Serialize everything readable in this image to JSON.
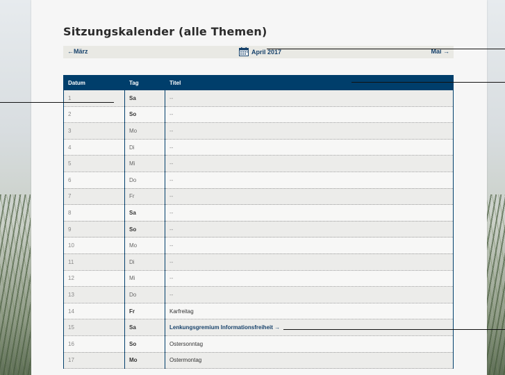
{
  "page": {
    "title": "Sitzungskalender (alle Themen)"
  },
  "nav": {
    "prev": "←März",
    "current": "April 2017",
    "next": "Mai →"
  },
  "table": {
    "headers": [
      "Datum",
      "Tag",
      "Titel"
    ],
    "rows": [
      {
        "date": "1",
        "day": "Sa",
        "title": "--"
      },
      {
        "date": "2",
        "day": "So",
        "title": "--"
      },
      {
        "date": "3",
        "day": "Mo",
        "title": "--"
      },
      {
        "date": "4",
        "day": "Di",
        "title": "--"
      },
      {
        "date": "5",
        "day": "Mi",
        "title": "--"
      },
      {
        "date": "6",
        "day": "Do",
        "title": "--"
      },
      {
        "date": "7",
        "day": "Fr",
        "title": "--"
      },
      {
        "date": "8",
        "day": "Sa",
        "title": "--"
      },
      {
        "date": "9",
        "day": "So",
        "title": "--"
      },
      {
        "date": "10",
        "day": "Mo",
        "title": "--"
      },
      {
        "date": "11",
        "day": "Di",
        "title": "--"
      },
      {
        "date": "12",
        "day": "Mi",
        "title": "--"
      },
      {
        "date": "13",
        "day": "Do",
        "title": "--"
      },
      {
        "date": "14",
        "day": "Fr",
        "title": "Karfreitag"
      },
      {
        "date": "15",
        "day": "Sa",
        "title": "Lenkungsgremium Informationsfreiheit →"
      },
      {
        "date": "16",
        "day": "So",
        "title": "Ostersonntag"
      },
      {
        "date": "17",
        "day": "Mo",
        "title": "Ostermontag"
      }
    ]
  },
  "icons": {
    "calendar": "calendar-icon"
  },
  "colors": {
    "header_bg": "#003e6b",
    "link": "#17426b"
  }
}
